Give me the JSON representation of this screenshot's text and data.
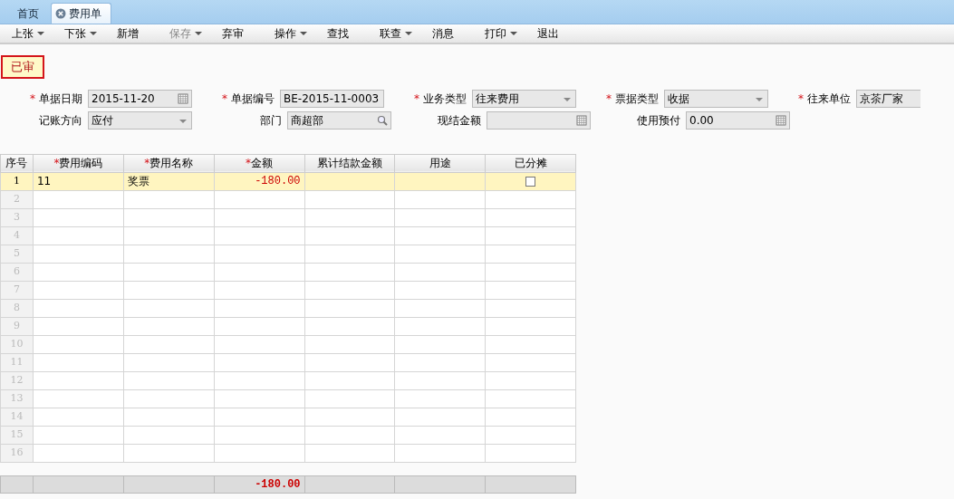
{
  "tabs": [
    {
      "label": "首页",
      "selected": false,
      "closable": false
    },
    {
      "label": "费用单",
      "selected": true,
      "closable": true
    }
  ],
  "toolbar": [
    {
      "label": "上张",
      "dropdown": true,
      "disabled": false
    },
    {
      "label": "下张",
      "dropdown": true,
      "disabled": false
    },
    {
      "label": "新增",
      "dropdown": false,
      "disabled": false
    },
    {
      "label": "保存",
      "dropdown": true,
      "disabled": true
    },
    {
      "label": "弃审",
      "dropdown": false,
      "disabled": false
    },
    {
      "label": "操作",
      "dropdown": true,
      "disabled": false
    },
    {
      "label": "查找",
      "dropdown": false,
      "disabled": false
    },
    {
      "label": "联查",
      "dropdown": true,
      "disabled": false
    },
    {
      "label": "消息",
      "dropdown": false,
      "disabled": false
    },
    {
      "label": "打印",
      "dropdown": true,
      "disabled": false
    },
    {
      "label": "退出",
      "dropdown": false,
      "disabled": false
    }
  ],
  "status_badge": "已审",
  "form_rows": [
    [
      {
        "mark": "*",
        "label": "单据日期",
        "value": "2015-11-20",
        "kind": "date"
      },
      {
        "mark": "*",
        "label": "单据编号",
        "value": "BE-2015-11-0003",
        "kind": "text"
      },
      {
        "mark": "*",
        "label": "业务类型",
        "value": "往来费用",
        "kind": "select"
      },
      {
        "mark": "*",
        "label": "票据类型",
        "value": "收据",
        "kind": "select"
      },
      {
        "mark": "*",
        "label": "往来单位",
        "value": "京茶厂家"
      }
    ],
    [
      {
        "label": "记账方向",
        "value": "应付",
        "kind": "select"
      },
      {
        "label": "部门",
        "value": "商超部",
        "kind": "lookup"
      },
      {
        "label": "现结金额",
        "kind": "number"
      },
      {
        "label": "使用预付",
        "value": "0.00",
        "kind": "number"
      }
    ]
  ],
  "table": {
    "columns": [
      {
        "label": "序号"
      },
      {
        "mark": "*",
        "label": "费用编码"
      },
      {
        "mark": "*",
        "label": "费用名称"
      },
      {
        "mark": "*",
        "label": "金额"
      },
      {
        "label": "累计结款金额"
      },
      {
        "label": "用途"
      },
      {
        "label": "已分摊"
      }
    ],
    "rows": [
      {
        "no": "1",
        "selected": true,
        "code": "11",
        "name": "奖票",
        "amount": "-180.00",
        "allocated": false
      },
      {
        "no": "2",
        "selected": false
      },
      {
        "no": "3",
        "selected": false
      },
      {
        "no": "4",
        "selected": false
      },
      {
        "no": "5",
        "selected": false
      },
      {
        "no": "6",
        "selected": false
      },
      {
        "no": "7",
        "selected": false
      },
      {
        "no": "8",
        "selected": false
      },
      {
        "no": "9",
        "selected": false
      },
      {
        "no": "10",
        "selected": false
      },
      {
        "no": "11",
        "selected": false
      },
      {
        "no": "12",
        "selected": false
      },
      {
        "no": "13",
        "selected": false
      },
      {
        "no": "14",
        "selected": false
      },
      {
        "no": "15",
        "selected": false
      },
      {
        "no": "16",
        "selected": false
      }
    ],
    "total_amount": "-180.00"
  }
}
